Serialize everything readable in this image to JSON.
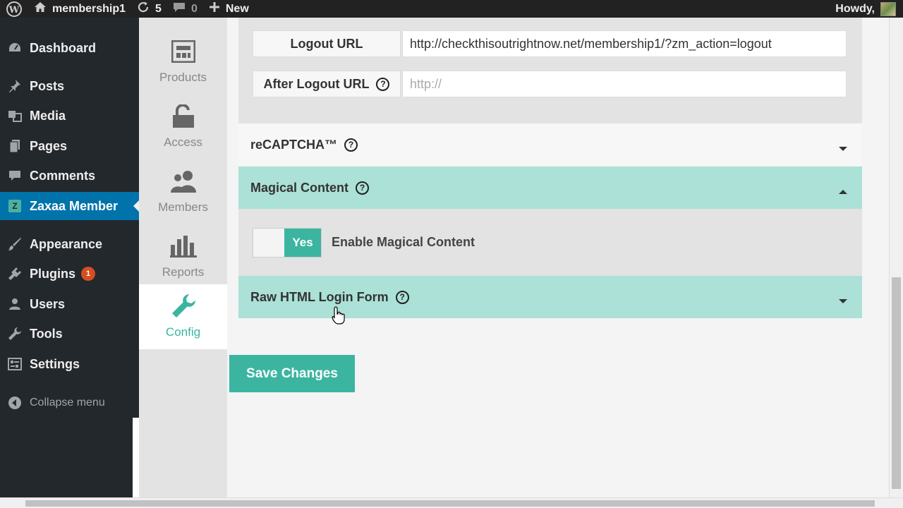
{
  "admin_bar": {
    "site_name": "membership1",
    "updates_count": "5",
    "comments_count": "0",
    "new_label": "New",
    "howdy": "Howdy,"
  },
  "sidebar": {
    "items": [
      {
        "label": "Dashboard",
        "icon": "dashboard-icon"
      },
      {
        "label": "Posts",
        "icon": "pin-icon"
      },
      {
        "label": "Media",
        "icon": "media-icon"
      },
      {
        "label": "Pages",
        "icon": "pages-icon"
      },
      {
        "label": "Comments",
        "icon": "comment-icon"
      },
      {
        "label": "Zaxaa Member",
        "icon": "zaxaa-icon",
        "current": true
      },
      {
        "label": "Appearance",
        "icon": "brush-icon"
      },
      {
        "label": "Plugins",
        "icon": "plugin-icon",
        "badge": "1"
      },
      {
        "label": "Users",
        "icon": "user-icon"
      },
      {
        "label": "Tools",
        "icon": "wrench-icon"
      },
      {
        "label": "Settings",
        "icon": "settings-icon"
      }
    ],
    "collapse_label": "Collapse menu"
  },
  "plugin_tabs": [
    {
      "label": "Products",
      "icon": "products-icon"
    },
    {
      "label": "Access",
      "icon": "unlock-icon"
    },
    {
      "label": "Members",
      "icon": "members-icon"
    },
    {
      "label": "Reports",
      "icon": "bar-chart-icon"
    },
    {
      "label": "Config",
      "icon": "wrench-icon",
      "active": true
    }
  ],
  "config": {
    "logout_url_label": "Logout URL",
    "logout_url_value": "http://checkthisoutrightnow.net/membership1/?zm_action=logout",
    "after_logout_label": "After Logout URL",
    "after_logout_placeholder": "http://",
    "sections": {
      "recaptcha": "reCAPTCHA™",
      "magical_content": "Magical Content",
      "raw_html": "Raw HTML Login Form"
    },
    "toggle_on_label": "Yes",
    "enable_magical_label": "Enable Magical Content",
    "save_button": "Save Changes"
  },
  "colors": {
    "accent": "#3bb5a0",
    "accordion_active": "#abe1d7",
    "wp_blue": "#0073aa",
    "sidebar_bg": "#23282d"
  }
}
